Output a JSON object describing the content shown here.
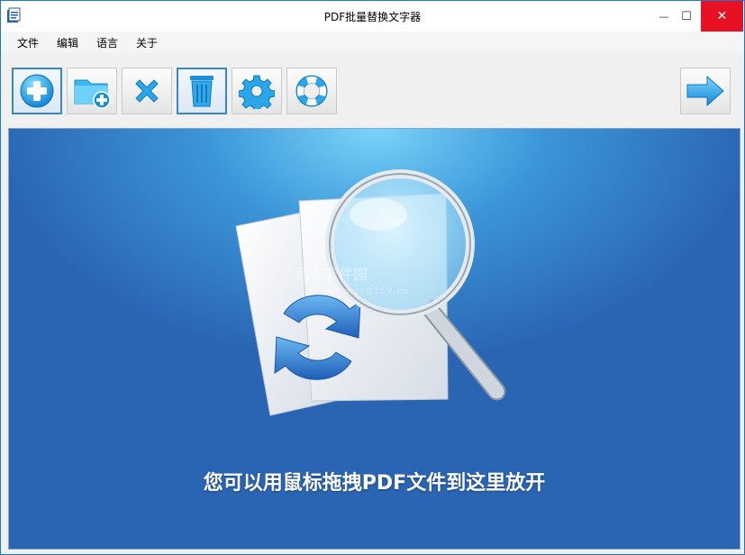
{
  "window": {
    "title": "PDF批量替换文字器",
    "controls": {
      "minimize": "—",
      "maximize": "☐",
      "close": "✕"
    }
  },
  "menu": {
    "items": [
      "文件",
      "编辑",
      "语言",
      "关于"
    ]
  },
  "toolbar": {
    "buttons": [
      {
        "name": "add-file-button",
        "icon": "plus-circle-icon"
      },
      {
        "name": "add-folder-button",
        "icon": "folder-plus-icon"
      },
      {
        "name": "remove-button",
        "icon": "x-icon"
      },
      {
        "name": "clear-button",
        "icon": "trash-icon"
      },
      {
        "name": "settings-button",
        "icon": "gear-icon"
      },
      {
        "name": "help-button",
        "icon": "lifebuoy-icon"
      },
      {
        "name": "next-button",
        "icon": "arrow-right-icon"
      }
    ]
  },
  "drop_area": {
    "hint": "您可以用鼠标拖拽PDF文件到这里放开",
    "watermark": "河东软件园",
    "watermark_url": "www.pc0359.cn"
  },
  "colors": {
    "accent": "#1e9be6",
    "close": "#e81123",
    "canvas_top": "#78d4fb",
    "canvas_bottom": "#2a65b4"
  }
}
